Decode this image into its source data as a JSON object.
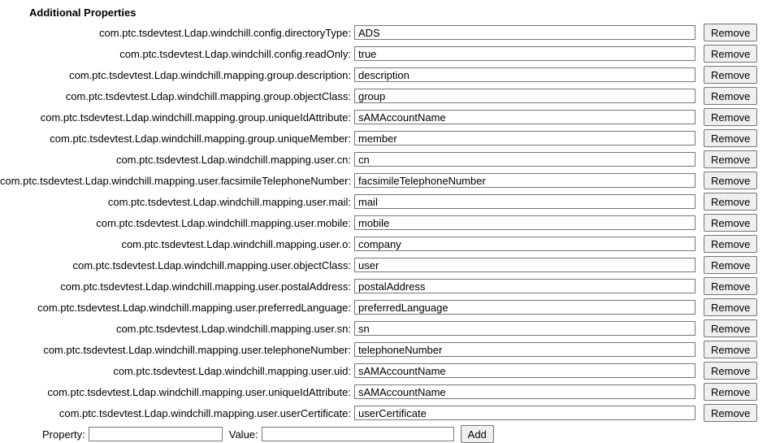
{
  "section_title": "Additional Properties",
  "remove_label": "Remove",
  "add_label": "Add",
  "new_property_label": "Property:",
  "new_value_label": "Value:",
  "new_property_value": "",
  "new_value_value": "",
  "properties": [
    {
      "key": "com.ptc.tsdevtest.Ldap.windchill.config.directoryType:",
      "value": "ADS"
    },
    {
      "key": "com.ptc.tsdevtest.Ldap.windchill.config.readOnly:",
      "value": "true"
    },
    {
      "key": "com.ptc.tsdevtest.Ldap.windchill.mapping.group.description:",
      "value": "description"
    },
    {
      "key": "com.ptc.tsdevtest.Ldap.windchill.mapping.group.objectClass:",
      "value": "group"
    },
    {
      "key": "com.ptc.tsdevtest.Ldap.windchill.mapping.group.uniqueIdAttribute:",
      "value": "sAMAccountName"
    },
    {
      "key": "com.ptc.tsdevtest.Ldap.windchill.mapping.group.uniqueMember:",
      "value": "member"
    },
    {
      "key": "com.ptc.tsdevtest.Ldap.windchill.mapping.user.cn:",
      "value": "cn"
    },
    {
      "key": "com.ptc.tsdevtest.Ldap.windchill.mapping.user.facsimileTelephoneNumber:",
      "value": "facsimileTelephoneNumber"
    },
    {
      "key": "com.ptc.tsdevtest.Ldap.windchill.mapping.user.mail:",
      "value": "mail"
    },
    {
      "key": "com.ptc.tsdevtest.Ldap.windchill.mapping.user.mobile:",
      "value": "mobile"
    },
    {
      "key": "com.ptc.tsdevtest.Ldap.windchill.mapping.user.o:",
      "value": "company"
    },
    {
      "key": "com.ptc.tsdevtest.Ldap.windchill.mapping.user.objectClass:",
      "value": "user"
    },
    {
      "key": "com.ptc.tsdevtest.Ldap.windchill.mapping.user.postalAddress:",
      "value": "postalAddress"
    },
    {
      "key": "com.ptc.tsdevtest.Ldap.windchill.mapping.user.preferredLanguage:",
      "value": "preferredLanguage"
    },
    {
      "key": "com.ptc.tsdevtest.Ldap.windchill.mapping.user.sn:",
      "value": "sn"
    },
    {
      "key": "com.ptc.tsdevtest.Ldap.windchill.mapping.user.telephoneNumber:",
      "value": "telephoneNumber"
    },
    {
      "key": "com.ptc.tsdevtest.Ldap.windchill.mapping.user.uid:",
      "value": "sAMAccountName"
    },
    {
      "key": "com.ptc.tsdevtest.Ldap.windchill.mapping.user.uniqueIdAttribute:",
      "value": "sAMAccountName"
    },
    {
      "key": "com.ptc.tsdevtest.Ldap.windchill.mapping.user.userCertificate:",
      "value": "userCertificate"
    }
  ]
}
